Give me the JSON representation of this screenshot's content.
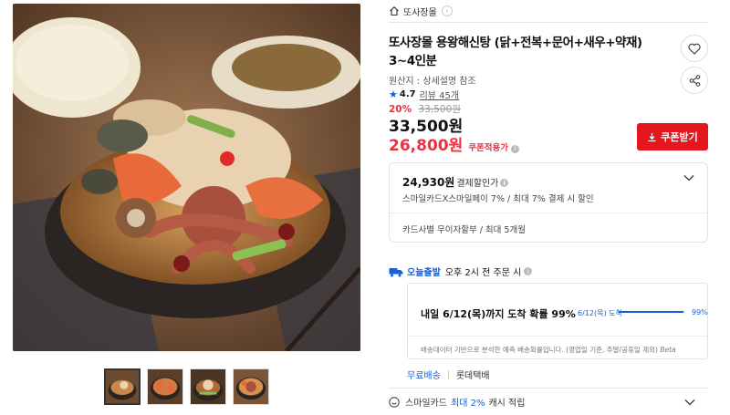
{
  "gallery": {
    "main_image_name": "product-main-image",
    "thumbnail_count": 4,
    "active_index": 0
  },
  "breadcrumb": {
    "store": "또사장몰"
  },
  "product": {
    "title": "또사장몰 용왕해신탕 (닭+전복+문어+새우+약재) 3~4인분",
    "origin": "원산지 : 상세설명 참조",
    "rating": "4.7",
    "review": "리뷰 45개"
  },
  "pricing": {
    "discount_pct": "20%",
    "original": "33,500원",
    "price": "33,500원",
    "coupon_price": "26,800원",
    "coupon_tag": "쿠폰적용가",
    "coupon_button": "쿠폰받기"
  },
  "payment": {
    "amount": "24,930원",
    "amount_label": "결제할인가",
    "desc": "스마일카드X스마일페이 7% / 최대 7% 결제 시 할인",
    "installment": "카드사별 무이자할부 / 최대 5개월"
  },
  "delivery": {
    "today_label": "오늘출발",
    "cutoff": "오후 2시 전 주문 시",
    "eta_title": "내일 6/12(목)까지 도착 확률 99%",
    "eta_label": "6/12(목) 도착",
    "eta_pct": "99%",
    "eta_fraction": 0.99,
    "eta_note": "배송데이터 기반으로 분석한 예측 배송확률입니다. (영업일 기준, 주말/공휴일 제외)",
    "eta_beta": "Beta",
    "shipping": "무료배송",
    "carrier": "롯데택배"
  },
  "card_benefit": {
    "card": "스마일카드",
    "max": "최대 2%",
    "accrual": "캐시 적립"
  },
  "colors": {
    "accent_red": "#e4161e",
    "price_red": "#f0303f",
    "brand_blue": "#1a5fd4"
  },
  "icons": [
    "home-icon",
    "heart-icon",
    "share-icon",
    "download-icon",
    "chevron-down-icon",
    "truck-icon",
    "smile-card-icon",
    "star-icon",
    "info-icon"
  ]
}
